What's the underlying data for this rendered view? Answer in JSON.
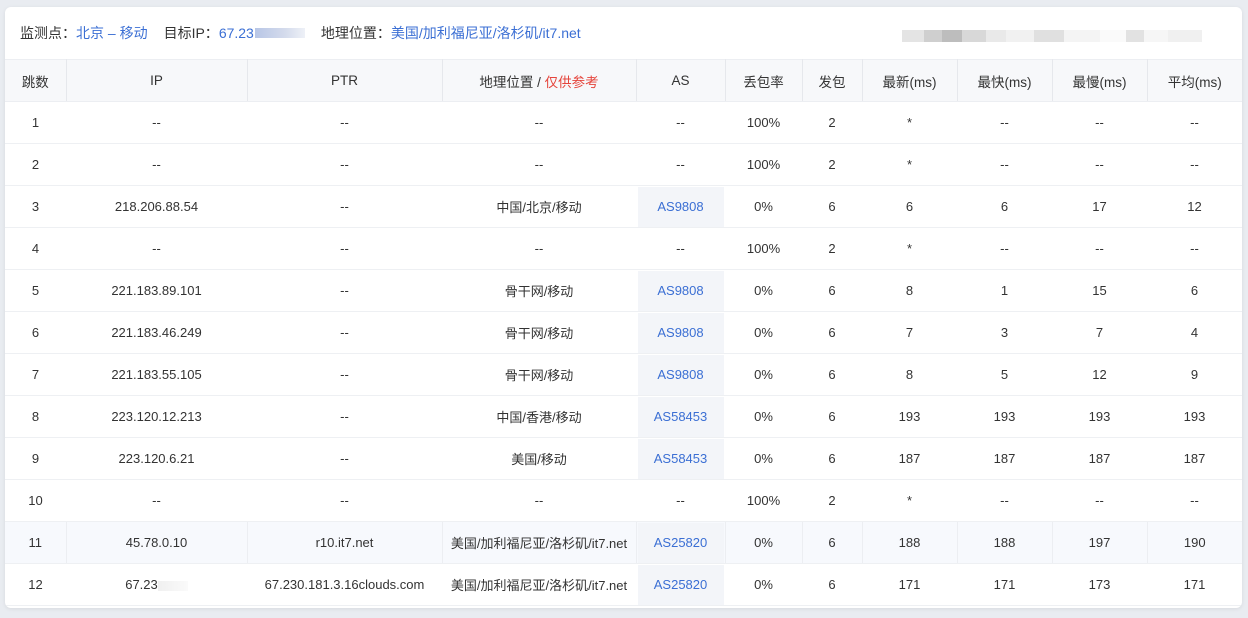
{
  "header": {
    "monitor_label": "监测点：",
    "monitor_value": "北京 – 移动",
    "target_label": "目标IP：",
    "target_value": "67.23",
    "geo_label": "地理位置：",
    "geo_value": "美国/加利福尼亚/洛杉矶/it7.net"
  },
  "table": {
    "columns": {
      "hop": "跳数",
      "ip": "IP",
      "ptr": "PTR",
      "geo": "地理位置 / ",
      "geo_note": "仅供参考",
      "as": "AS",
      "loss": "丢包率",
      "sent": "发包",
      "last": "最新(ms)",
      "best": "最快(ms)",
      "worst": "最慢(ms)",
      "avg": "平均(ms)"
    },
    "rows": [
      {
        "hop": "1",
        "ip": "--",
        "ptr": "--",
        "geo": "--",
        "as": "--",
        "loss": "100%",
        "sent": "2",
        "last": "*",
        "best": "--",
        "worst": "--",
        "avg": "--"
      },
      {
        "hop": "2",
        "ip": "--",
        "ptr": "--",
        "geo": "--",
        "as": "--",
        "loss": "100%",
        "sent": "2",
        "last": "*",
        "best": "--",
        "worst": "--",
        "avg": "--"
      },
      {
        "hop": "3",
        "ip": "218.206.88.54",
        "ptr": "--",
        "geo": "中国/北京/移动",
        "as": "AS9808",
        "loss": "0%",
        "sent": "6",
        "last": "6",
        "best": "6",
        "worst": "17",
        "avg": "12"
      },
      {
        "hop": "4",
        "ip": "--",
        "ptr": "--",
        "geo": "--",
        "as": "--",
        "loss": "100%",
        "sent": "2",
        "last": "*",
        "best": "--",
        "worst": "--",
        "avg": "--"
      },
      {
        "hop": "5",
        "ip": "221.183.89.101",
        "ptr": "--",
        "geo": "骨干网/移动",
        "as": "AS9808",
        "loss": "0%",
        "sent": "6",
        "last": "8",
        "best": "1",
        "worst": "15",
        "avg": "6"
      },
      {
        "hop": "6",
        "ip": "221.183.46.249",
        "ptr": "--",
        "geo": "骨干网/移动",
        "as": "AS9808",
        "loss": "0%",
        "sent": "6",
        "last": "7",
        "best": "3",
        "worst": "7",
        "avg": "4"
      },
      {
        "hop": "7",
        "ip": "221.183.55.105",
        "ptr": "--",
        "geo": "骨干网/移动",
        "as": "AS9808",
        "loss": "0%",
        "sent": "6",
        "last": "8",
        "best": "5",
        "worst": "12",
        "avg": "9"
      },
      {
        "hop": "8",
        "ip": "223.120.12.213",
        "ptr": "--",
        "geo": "中国/香港/移动",
        "as": "AS58453",
        "loss": "0%",
        "sent": "6",
        "last": "193",
        "best": "193",
        "worst": "193",
        "avg": "193"
      },
      {
        "hop": "9",
        "ip": "223.120.6.21",
        "ptr": "--",
        "geo": "美国/移动",
        "as": "AS58453",
        "loss": "0%",
        "sent": "6",
        "last": "187",
        "best": "187",
        "worst": "187",
        "avg": "187"
      },
      {
        "hop": "10",
        "ip": "--",
        "ptr": "--",
        "geo": "--",
        "as": "--",
        "loss": "100%",
        "sent": "2",
        "last": "*",
        "best": "--",
        "worst": "--",
        "avg": "--"
      },
      {
        "hop": "11",
        "ip": "45.78.0.10",
        "ptr": "r10.it7.net",
        "geo": "美国/加利福尼亚/洛杉矶/it7.net",
        "as": "AS25820",
        "loss": "0%",
        "sent": "6",
        "last": "188",
        "best": "188",
        "worst": "197",
        "avg": "190"
      },
      {
        "hop": "12",
        "ip": "67.23",
        "ptr": "67.230.181.3.16clouds.com",
        "geo": "美国/加利福尼亚/洛杉矶/it7.net",
        "as": "AS25820",
        "loss": "0%",
        "sent": "6",
        "last": "171",
        "best": "171",
        "worst": "173",
        "avg": "171"
      }
    ]
  },
  "colors": {
    "link": "#3b6fd4",
    "note": "#e5453c",
    "header_bg": "#f7f8fa",
    "highlight_row_bg": "#f7f9fd"
  }
}
